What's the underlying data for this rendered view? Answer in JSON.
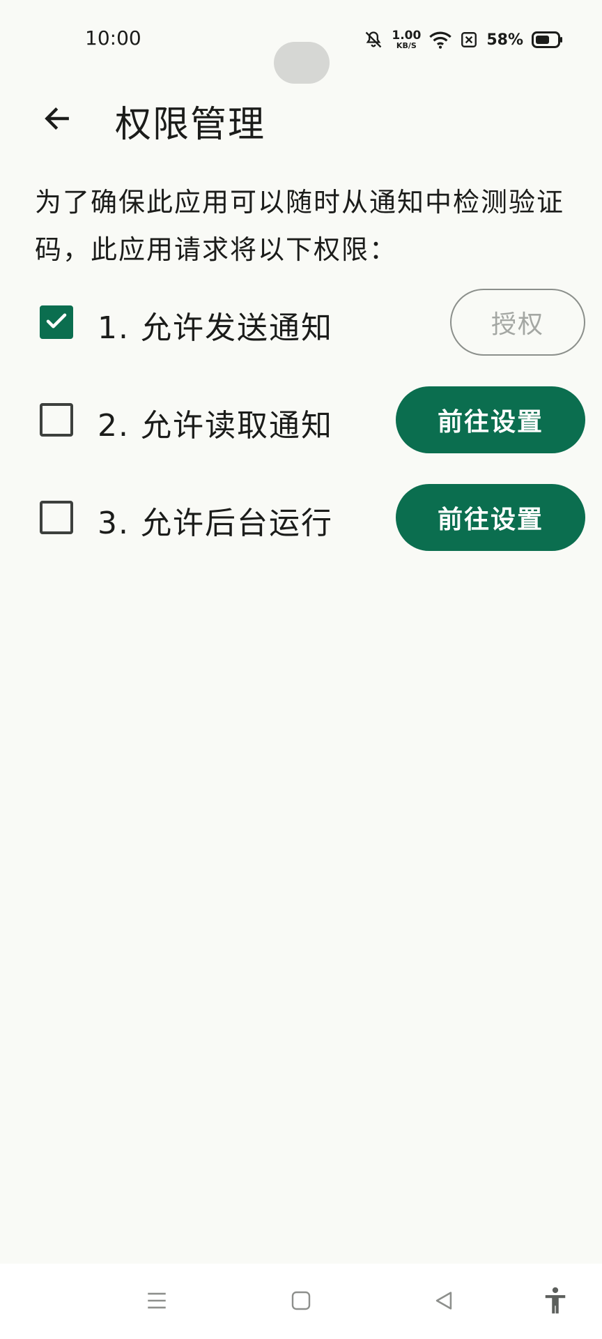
{
  "status_bar": {
    "time": "10:00",
    "net_speed_value": "1.00",
    "net_speed_unit": "KB/S",
    "battery_percent": "58%"
  },
  "app_bar": {
    "title": "权限管理",
    "back_icon": "arrow-back-icon"
  },
  "description": "为了确保此应用可以随时从通知中检测验证码，此应用请求将以下权限：",
  "permissions": [
    {
      "label": "1. 允许发送通知",
      "checked": true,
      "button_label": "授权",
      "button_style": "outline"
    },
    {
      "label": "2. 允许读取通知",
      "checked": false,
      "button_label": "前往设置",
      "button_style": "filled"
    },
    {
      "label": "3. 允许后台运行",
      "checked": false,
      "button_label": "前往设置",
      "button_style": "filled"
    }
  ],
  "nav_bar": {
    "icons": [
      "menu-icon",
      "home-square-icon",
      "back-triangle-icon",
      "accessibility-icon"
    ]
  },
  "colors": {
    "accent": "#0b6e4f",
    "background": "#f9faf6",
    "nav_background": "#ffffff"
  }
}
